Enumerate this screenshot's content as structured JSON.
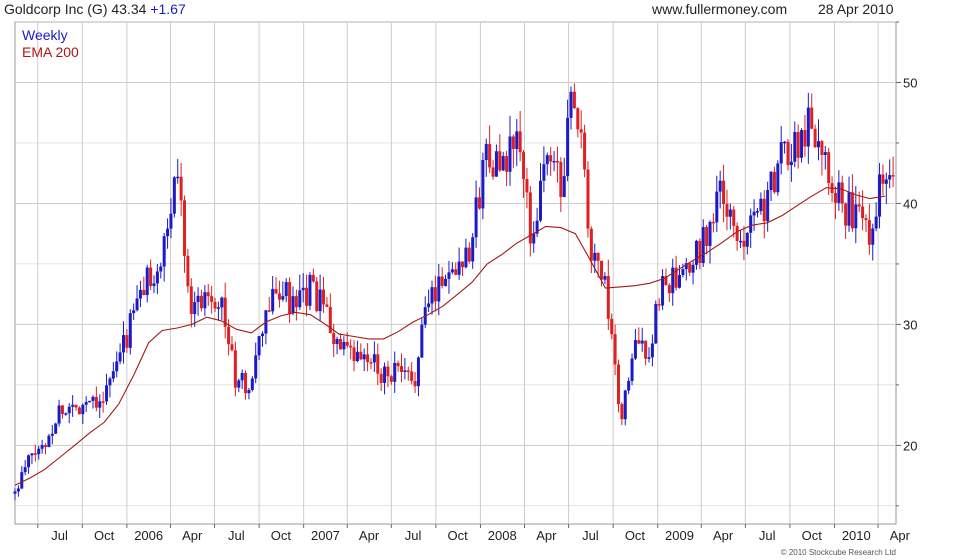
{
  "header": {
    "name": "Goldcorp Inc (G)",
    "price": "43.34",
    "change": "+1.67",
    "site": "www.fullermoney.com",
    "date": "28 Apr 2010"
  },
  "copyright": "© 2010 Stockcube Research Ltd",
  "colors": {
    "up": "#1a1ac8",
    "down": "#e02020",
    "ema": "#a51818",
    "grid": "#cccccc"
  },
  "chart_data": {
    "type": "candlestick",
    "ylim": [
      13.5,
      55
    ],
    "yticks": [
      20,
      30,
      40,
      50
    ],
    "xlabels": [
      "Jul",
      "Oct",
      "2006",
      "Apr",
      "Jul",
      "Oct",
      "2007",
      "Apr",
      "Jul",
      "Oct",
      "2008",
      "Apr",
      "Jul",
      "Oct",
      "2009",
      "Apr",
      "Jul",
      "Oct",
      "2010",
      "Apr"
    ],
    "legend": [
      "Weekly",
      "EMA 200"
    ],
    "price_series": {
      "name": "Weekly",
      "dates": [
        "2005-05",
        "2005-06",
        "2005-07",
        "2005-08",
        "2005-09",
        "2005-10",
        "2005-11",
        "2005-12",
        "2006-01",
        "2006-02",
        "2006-03",
        "2006-04",
        "2006-05",
        "2006-06",
        "2006-07",
        "2006-08",
        "2006-09",
        "2006-10",
        "2006-11",
        "2006-12",
        "2007-01",
        "2007-02",
        "2007-03",
        "2007-04",
        "2007-05",
        "2007-06",
        "2007-07",
        "2007-08",
        "2007-09",
        "2007-10",
        "2007-11",
        "2007-12",
        "2008-01",
        "2008-02",
        "2008-03",
        "2008-04",
        "2008-05",
        "2008-06",
        "2008-07",
        "2008-08",
        "2008-09",
        "2008-10",
        "2008-11",
        "2008-12",
        "2009-01",
        "2009-02",
        "2009-03",
        "2009-04",
        "2009-05",
        "2009-06",
        "2009-07",
        "2009-08",
        "2009-09",
        "2009-10",
        "2009-11",
        "2009-12",
        "2010-01",
        "2010-02",
        "2010-03",
        "2010-04"
      ],
      "values": [
        16,
        19,
        20,
        23,
        23,
        24,
        24,
        27,
        31,
        34,
        35,
        43,
        31,
        33,
        32,
        25,
        25,
        31,
        33,
        31,
        33,
        31,
        28,
        27,
        27,
        26,
        26,
        25,
        32,
        34,
        35,
        37,
        45,
        42,
        46,
        37,
        44,
        42,
        50,
        36,
        33,
        22,
        28,
        28,
        34,
        33,
        35,
        38,
        41,
        36,
        40,
        40,
        44,
        45,
        47,
        44,
        40,
        39,
        38,
        43.34
      ]
    },
    "ema_series": {
      "name": "EMA 200",
      "dates": [
        "2005-05",
        "2005-06",
        "2005-07",
        "2005-08",
        "2005-09",
        "2005-10",
        "2005-11",
        "2005-12",
        "2006-01",
        "2006-02",
        "2006-03",
        "2006-04",
        "2006-05",
        "2006-06",
        "2006-07",
        "2006-08",
        "2006-09",
        "2006-10",
        "2006-11",
        "2006-12",
        "2007-01",
        "2007-02",
        "2007-03",
        "2007-04",
        "2007-05",
        "2007-06",
        "2007-07",
        "2007-08",
        "2007-09",
        "2007-10",
        "2007-11",
        "2007-12",
        "2008-01",
        "2008-02",
        "2008-03",
        "2008-04",
        "2008-05",
        "2008-06",
        "2008-07",
        "2008-08",
        "2008-09",
        "2008-10",
        "2008-11",
        "2008-12",
        "2009-01",
        "2009-02",
        "2009-03",
        "2009-04",
        "2009-05",
        "2009-06",
        "2009-07",
        "2009-08",
        "2009-09",
        "2009-10",
        "2009-11",
        "2009-12",
        "2010-01",
        "2010-02",
        "2010-03",
        "2010-04"
      ],
      "values": [
        16.7,
        17.3,
        18.0,
        19.0,
        20.0,
        21.0,
        21.9,
        23.4,
        25.8,
        28.5,
        29.5,
        29.7,
        30.0,
        30.6,
        30.3,
        29.6,
        29.3,
        30.2,
        30.7,
        31.0,
        30.8,
        30.0,
        29.2,
        29.0,
        28.8,
        28.8,
        29.4,
        30.2,
        30.8,
        31.5,
        32.5,
        33.5,
        35.0,
        35.8,
        36.7,
        37.4,
        38.1,
        38.0,
        37.5,
        35.3,
        33.0,
        33.1,
        33.2,
        33.4,
        33.8,
        34.6,
        35.3,
        36.0,
        36.8,
        37.7,
        38.2,
        38.4,
        39.0,
        39.8,
        40.6,
        41.3,
        41.2,
        40.7,
        40.4,
        40.6
      ]
    }
  }
}
